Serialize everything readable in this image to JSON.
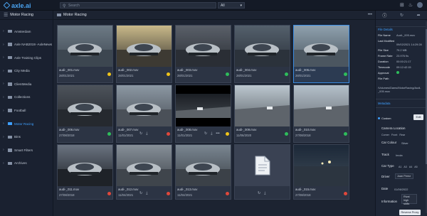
{
  "app": {
    "logo_text": "axle.ai"
  },
  "topbar": {
    "search_placeholder": "Search",
    "scope_value": "All",
    "icons": [
      "grid-icon",
      "bell-icon",
      "user-avatar"
    ]
  },
  "sidebar": {
    "header": "Motor Racing",
    "items": [
      {
        "label": "Amsterdam",
        "active": false
      },
      {
        "label": "Axle NAB2019 -AxleNews",
        "active": false
      },
      {
        "label": "Axle Training Clips",
        "active": false
      },
      {
        "label": "City Media",
        "active": false
      },
      {
        "label": "ClientMedia",
        "active": false
      },
      {
        "label": "Collections",
        "active": false
      },
      {
        "label": "Football",
        "active": false
      },
      {
        "label": "Motor Racing",
        "active": true
      },
      {
        "label": "Bins",
        "active": false
      },
      {
        "label": "Smart Filters",
        "active": false
      },
      {
        "label": "Archives",
        "active": false
      }
    ]
  },
  "main": {
    "title": "Motor Racing",
    "tiles": [
      {
        "name": "audi-_001.mov",
        "date": "28/01/2021",
        "status": "yellow",
        "scene": "track-cars"
      },
      {
        "name": "audi-_002.mov",
        "date": "28/01/2021",
        "status": "yellow",
        "scene": "sunset-car"
      },
      {
        "name": "audi-_003.mov",
        "date": "28/01/2021",
        "status": "green",
        "scene": "car-front"
      },
      {
        "name": "audi-_004.mov",
        "date": "28/01/2021",
        "status": "green",
        "scene": "silver-car"
      },
      {
        "name": "audi-_005.mov",
        "date": "28/01/2021",
        "status": "green",
        "scene": "silver-car-track",
        "selected": true
      },
      {
        "name": "audi-_006.mov",
        "date": "27/08/2018",
        "status": "green",
        "scene": "car-grille"
      },
      {
        "name": "audi-_007.mov",
        "date": "11/01/2021",
        "status": "red",
        "scene": "track-rear"
      },
      {
        "name": "audi-_008.mov",
        "date": "11/01/2021",
        "status": "yellow",
        "scene": "track-straight",
        "hover": true
      },
      {
        "name": "audi-_009.mov",
        "date": "11/06/2020",
        "status": "green",
        "scene": "track-sky"
      },
      {
        "name": "audi-_010.mov",
        "date": "27/08/2018",
        "status": "green",
        "scene": "track-curve"
      },
      {
        "name": "audi-_011.mov",
        "date": "27/08/2018",
        "status": "red",
        "scene": "car-dark"
      },
      {
        "name": "audi-_012.mov",
        "date": "11/04/2021",
        "status": "red",
        "scene": "cars-track"
      },
      {
        "name": "audi-_013.mov",
        "date": "11/04/2021",
        "status": "red",
        "scene": "white-car"
      },
      {
        "name": "",
        "date": "",
        "status": "",
        "scene": "document"
      },
      {
        "name": "audi-_015.mov",
        "date": "27/08/2018",
        "status": "red",
        "scene": "night-track"
      }
    ],
    "hover_actions": [
      "sync-icon",
      "download-icon",
      "more-icon"
    ]
  },
  "panel": {
    "tabs": [
      "info-icon",
      "sync-icon",
      "share-icon"
    ],
    "file_section_title": "File Details",
    "fields": [
      {
        "k": "File Name",
        "v": "Audi-_005.mov"
      },
      {
        "k": "Last Modified",
        "v": ""
      },
      {
        "k": "",
        "v": "09/02/2021 14:29:28"
      },
      {
        "k": "File Size",
        "v": "79.2 MB"
      },
      {
        "k": "Frame Rate",
        "v": "23.976 f/s"
      },
      {
        "k": "Duration",
        "v": "00:00:21:17"
      },
      {
        "k": "Timecode",
        "v": "09:12:42:15"
      },
      {
        "k": "Approval",
        "v": ""
      },
      {
        "k": "File Path",
        "v": ""
      }
    ],
    "file_path": "/Volumes/Dams/MotorRacing/Audi-_005.mov",
    "meta_section_title": "Metadata",
    "custom_label": "Custom",
    "edit_label": "Edit",
    "camera_location_label": "Camera Location",
    "camera_locations": [
      "Corner",
      "Front",
      "Rear"
    ],
    "car_colour_label": "Car Colour",
    "car_colour_value": "Silver",
    "track_label": "Track",
    "track_value": "Imola",
    "car_type_label": "Car Type",
    "car_types": [
      "A1",
      "A3",
      "A4",
      "A5"
    ],
    "driver_label": "Driver",
    "driver_value": "Joan Perez",
    "date_label": "Date",
    "date_value": "01/06/2022",
    "information_label": "Information",
    "information_value": "Rival high skills",
    "tooltip": "Reverse Proxy",
    "colors": {
      "accent": "#3fa0ff",
      "green": "#2ebd5b",
      "yellow": "#f0c419",
      "red": "#e0473b"
    }
  }
}
